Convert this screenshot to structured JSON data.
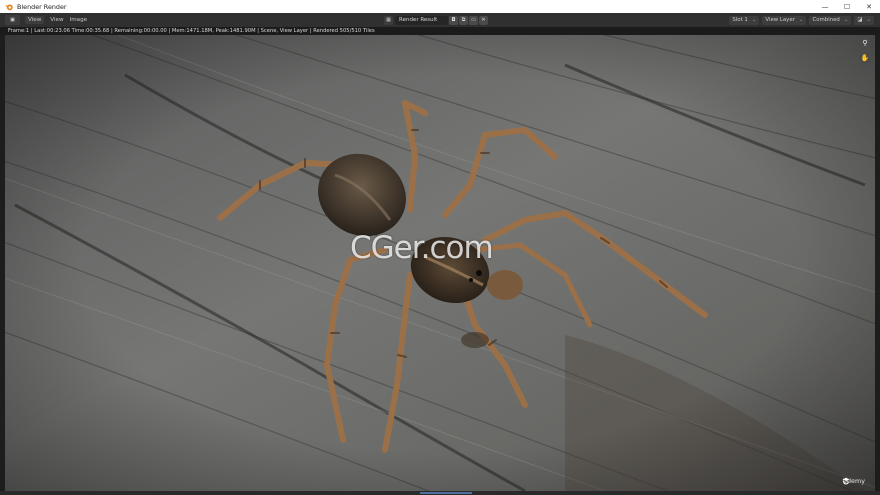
{
  "window": {
    "title": "Blender Render",
    "controls": {
      "minimize": "—",
      "maximize": "☐",
      "close": "✕"
    }
  },
  "header": {
    "editor_type_icon": "image-editor-icon",
    "menu": [
      "View",
      "View",
      "Image"
    ],
    "image_name": "Render Result",
    "slot": "Slot 1",
    "view_layer": "View Layer",
    "pass": "Combined"
  },
  "status": {
    "text": "Frame:1 | Last:00:23.06 Time:00:35.68 | Remaining:00:00.00 | Mem:1471.18M, Peak:1481.90M | Scene, View Layer | Rendered 505/510 Tiles"
  },
  "overlay": {
    "watermark": "CGer.com",
    "brand": "Udemy"
  },
  "colors": {
    "title_bar": "#ffffff",
    "header_bg": "#303030",
    "status_bg": "#1b1b1b",
    "wood": "#6b6c6b",
    "spider_body": "#3a3128",
    "spider_leg": "#9b7049"
  }
}
